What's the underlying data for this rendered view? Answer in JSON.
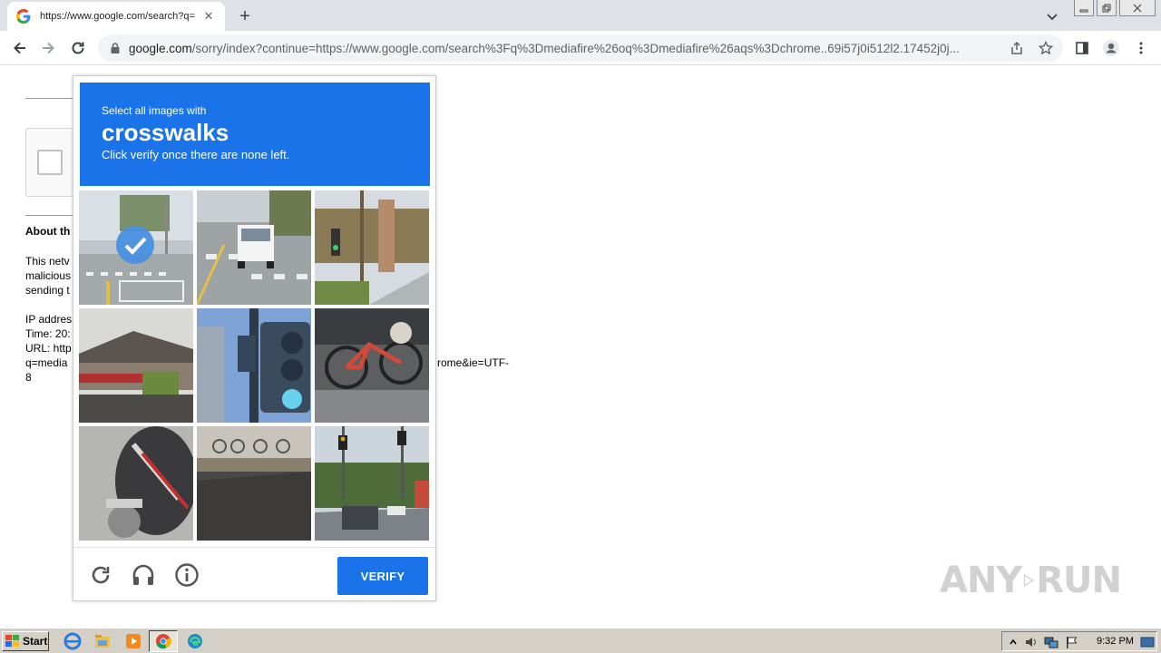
{
  "browser": {
    "tab_title": "https://www.google.com/search?q=",
    "tab_close": "✕",
    "new_tab": "+",
    "url_host": "google.com",
    "url_rest": "/sorry/index?continue=https://www.google.com/search%3Fq%3Dmediafire%26oq%3Dmediafire%26aqs%3Dchrome..69i57j0i512l2.17452j0j..."
  },
  "page": {
    "about_heading": "About th",
    "para_line1": "This netv",
    "para_line2": "malicious",
    "para_line3": "sending t",
    "ip_line": "IP addres",
    "time_line": "Time: 20:",
    "url_line": "URL: http",
    "q_line": "q=media",
    "q_line_tail": "rome&ie=UTF-",
    "last_line": "8"
  },
  "captcha": {
    "intro": "Select all images with",
    "keyword": "crosswalks",
    "instruction": "Click verify once there are none left.",
    "verify_label": "VERIFY",
    "tiles": [
      {
        "name": "tile-street-crosswalk-1",
        "selected": true
      },
      {
        "name": "tile-street-crosswalk-truck",
        "selected": false
      },
      {
        "name": "tile-traffic-light-palms",
        "selected": false
      },
      {
        "name": "tile-house-roof",
        "selected": false
      },
      {
        "name": "tile-traffic-light-closeup",
        "selected": false
      },
      {
        "name": "tile-bicycle",
        "selected": false
      },
      {
        "name": "tile-motorcycle",
        "selected": false
      },
      {
        "name": "tile-bikes-wall",
        "selected": false
      },
      {
        "name": "tile-road-cars",
        "selected": false
      }
    ]
  },
  "watermark": {
    "left": "ANY",
    "right": "RUN"
  },
  "taskbar": {
    "start_label": "Start",
    "clock": "9:32 PM"
  },
  "colors": {
    "accent": "#1a73e8"
  }
}
